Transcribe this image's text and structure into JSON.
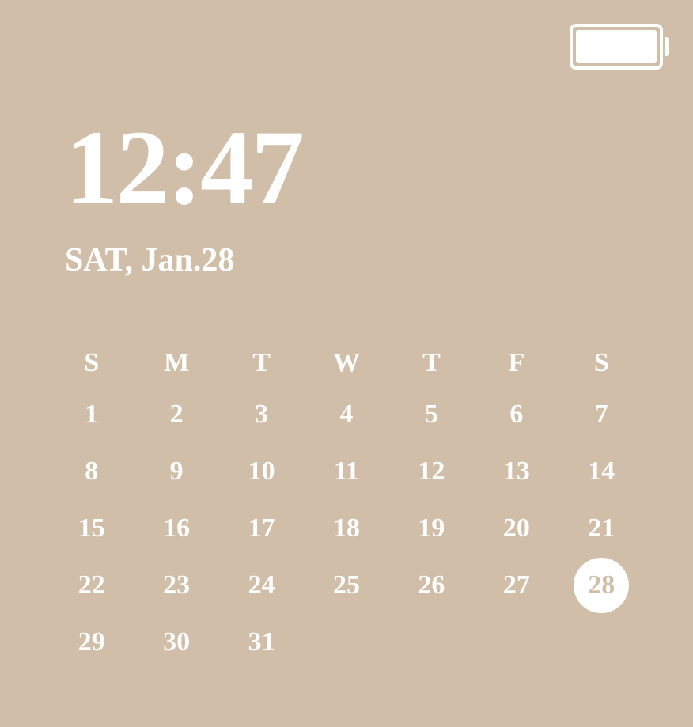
{
  "status": {
    "battery_percent": 100
  },
  "clock": {
    "time": "12:47",
    "date": "SAT, Jan.28"
  },
  "calendar": {
    "weekdays": [
      "S",
      "M",
      "T",
      "W",
      "T",
      "F",
      "S"
    ],
    "today": 28,
    "days_in_month": 31,
    "start_weekday": 0
  }
}
